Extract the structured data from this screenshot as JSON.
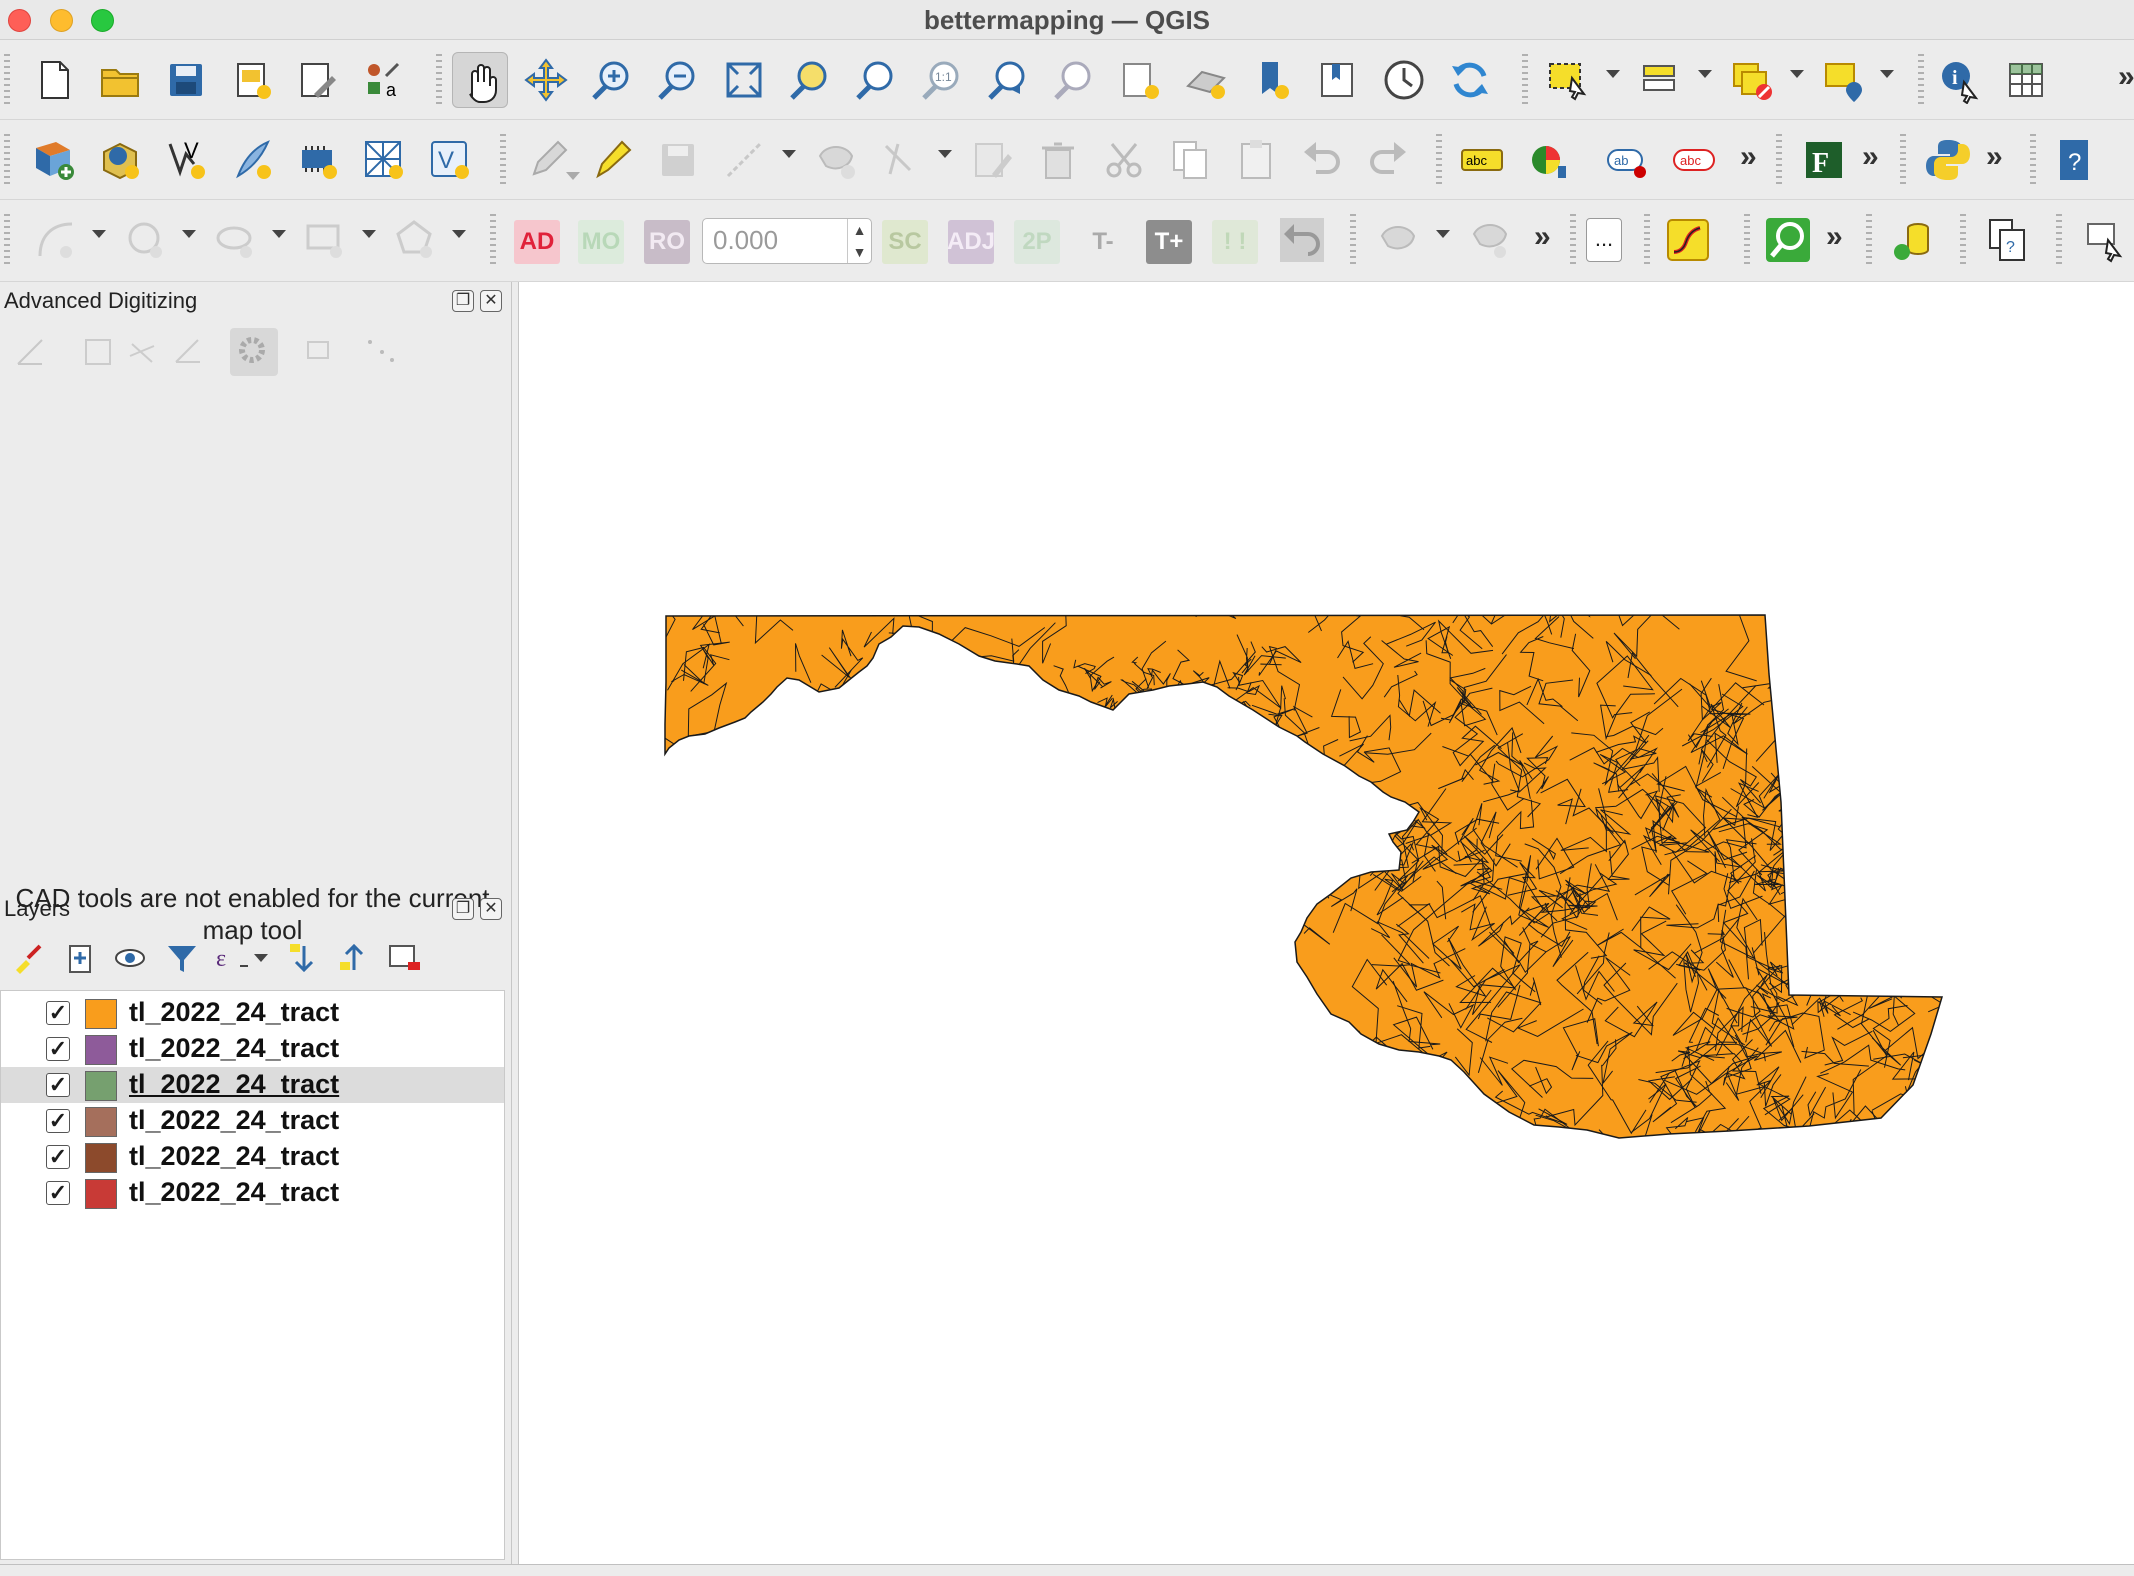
{
  "window": {
    "title": "bettermapping — QGIS"
  },
  "toolbar3": {
    "ad": "AD",
    "mo": "MO",
    "ro": "RO",
    "value": "0.000",
    "sc": "SC",
    "adj": "ADJ",
    "tp": "2P",
    "tminus": "T-",
    "tplus": "T+",
    "excl": "! !",
    "ellipsis": "..."
  },
  "overflow": "»",
  "digitizing_panel": {
    "title": "Advanced Digitizing",
    "message": "CAD tools are not enabled for the current map tool"
  },
  "layers_panel": {
    "title": "Layers",
    "layers": [
      {
        "name": "tl_2022_24_tract",
        "color": "#f99d1c",
        "checked": true
      },
      {
        "name": "tl_2022_24_tract",
        "color": "#8e5b9a",
        "checked": true
      },
      {
        "name": "tl_2022_24_tract",
        "color": "#76a06f",
        "checked": true,
        "selected": true
      },
      {
        "name": "tl_2022_24_tract",
        "color": "#a56f5c",
        "checked": true
      },
      {
        "name": "tl_2022_24_tract",
        "color": "#8c4a2c",
        "checked": true
      },
      {
        "name": "tl_2022_24_tract",
        "color": "#c83a36",
        "checked": true
      }
    ]
  },
  "map": {
    "fill_color": "#f99d1c",
    "stroke_color": "#1a1a1a"
  }
}
